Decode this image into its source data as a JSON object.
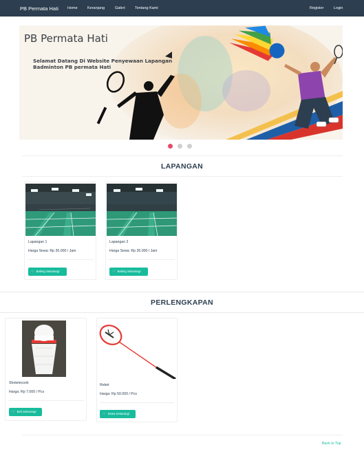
{
  "navbar": {
    "brand": "PB Permata Hati",
    "links": [
      "Home",
      "Keranjang",
      "Galeri",
      "Tentang Kami"
    ],
    "right_links": [
      "Register",
      "Login"
    ]
  },
  "banner": {
    "title": "PB Permata Hati",
    "subtitle_line1": "Selamat Datang Di Website Penyewaan Lapangan",
    "subtitle_line2": "Badminton PB permata Hati"
  },
  "carousel": {
    "slide_count": 3,
    "active_index": 0
  },
  "lapangan": {
    "heading": "LAPANGAN",
    "cards": [
      {
        "name": "Lapangan 1",
        "price": "Harga Sewa: Rp 35.000 / Jam",
        "button": "Boking Sekarang!"
      },
      {
        "name": "Lapangan 2",
        "price": "Harga Sewa: Rp 35.000 / Jam",
        "button": "Boking Sekarang!"
      }
    ]
  },
  "perlengkapan": {
    "heading": "PERLENGKAPAN",
    "cards": [
      {
        "name": "Shotelecook",
        "price": "Harga: Rp 7.000 / Pcs",
        "button": "Beli Sekarang!"
      },
      {
        "name": "Reket",
        "price": "Harga: Rp 50.000 / Pcs",
        "button": "Sewa Sekarang!"
      }
    ]
  },
  "footer": {
    "back_to_top": "Back to Top"
  },
  "colors": {
    "navbar": "#2c3e50",
    "accent": "#18bc9c",
    "active_dot": "#e84b6b"
  },
  "icons": {
    "button_icon": "shopping-cart-icon"
  }
}
